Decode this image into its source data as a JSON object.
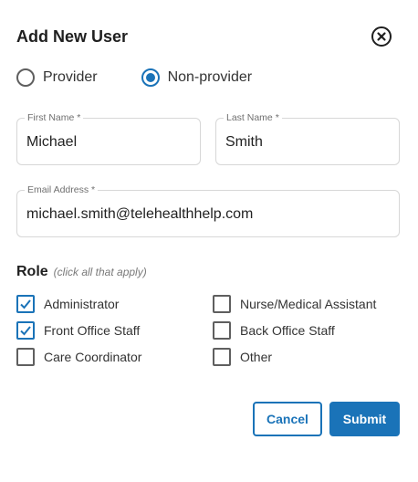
{
  "dialog": {
    "title": "Add New User",
    "close_icon": "close-circle-icon"
  },
  "user_type": {
    "options": [
      {
        "label": "Provider",
        "selected": false
      },
      {
        "label": "Non-provider",
        "selected": true
      }
    ]
  },
  "fields": {
    "first_name": {
      "label": "First Name *",
      "value": "Michael"
    },
    "last_name": {
      "label": "Last Name *",
      "value": "Smith"
    },
    "email": {
      "label": "Email Address *",
      "value": "michael.smith@telehealthhelp.com"
    }
  },
  "role": {
    "title": "Role",
    "hint": "(click all that apply)",
    "options": [
      {
        "label": "Administrator",
        "checked": true
      },
      {
        "label": "Nurse/Medical Assistant",
        "checked": false
      },
      {
        "label": "Front Office Staff",
        "checked": true
      },
      {
        "label": "Back Office Staff",
        "checked": false
      },
      {
        "label": "Care Coordinator",
        "checked": false
      },
      {
        "label": "Other",
        "checked": false
      }
    ]
  },
  "actions": {
    "cancel_label": "Cancel",
    "submit_label": "Submit"
  },
  "colors": {
    "accent": "#1a73b8",
    "text": "#212121",
    "border": "#d7d7d7"
  }
}
